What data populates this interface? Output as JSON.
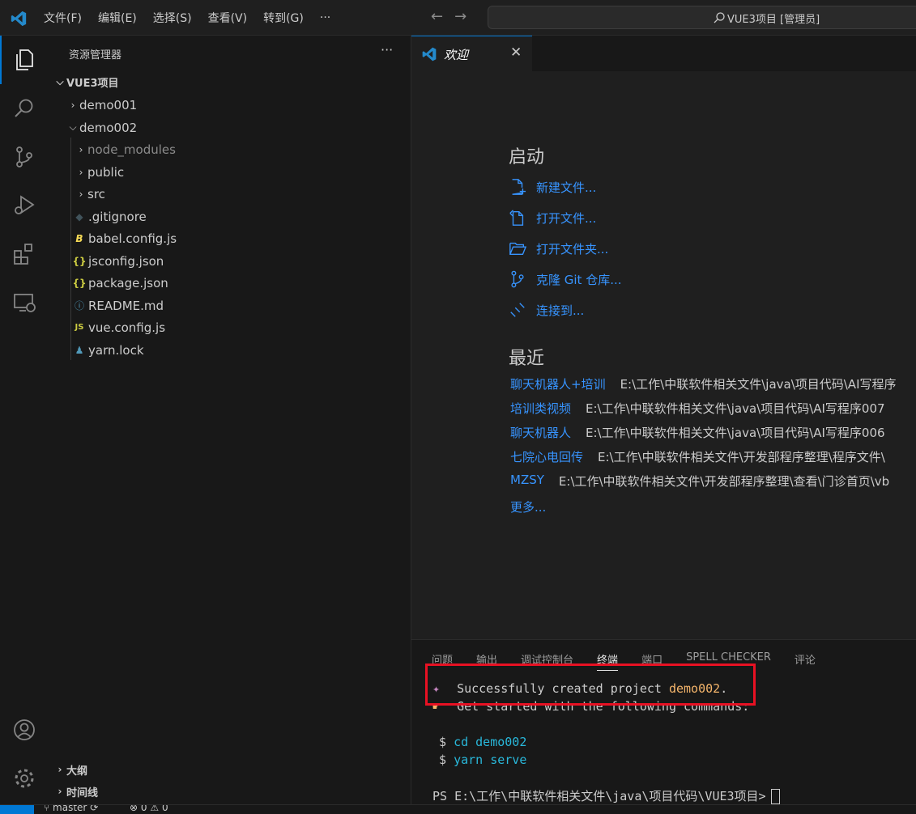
{
  "menu": [
    "文件(F)",
    "编辑(E)",
    "选择(S)",
    "查看(V)",
    "转到(G)"
  ],
  "menu_more": "···",
  "search": {
    "label": "VUE3项目 [管理员]"
  },
  "sidebar": {
    "title": "资源管理器",
    "more": "···",
    "root": "VUE3项目",
    "items": [
      {
        "label": "demo001",
        "kind": "folder",
        "expanded": false
      },
      {
        "label": "demo002",
        "kind": "folder",
        "expanded": true
      },
      {
        "label": "node_modules",
        "kind": "folder",
        "expanded": false
      },
      {
        "label": "public",
        "kind": "folder",
        "expanded": false
      },
      {
        "label": "src",
        "kind": "folder",
        "expanded": false
      },
      {
        "label": ".gitignore",
        "kind": "file",
        "icon": "git-icon"
      },
      {
        "label": "babel.config.js",
        "kind": "file",
        "icon": "babel-icon",
        "glyph": "B"
      },
      {
        "label": "jsconfig.json",
        "kind": "file",
        "icon": "json-icon",
        "glyph": "{}"
      },
      {
        "label": "package.json",
        "kind": "file",
        "icon": "json-icon",
        "glyph": "{}"
      },
      {
        "label": "README.md",
        "kind": "file",
        "icon": "info-icon",
        "glyph": "ⓘ"
      },
      {
        "label": "vue.config.js",
        "kind": "file",
        "icon": "js-icon",
        "glyph": "JS"
      },
      {
        "label": "yarn.lock",
        "kind": "file",
        "icon": "yarn-icon"
      }
    ],
    "outline": "大纲",
    "timeline": "时间线"
  },
  "tab": {
    "label": "欢迎",
    "close": "✕"
  },
  "welcome": {
    "start_heading": "启动",
    "start_items": [
      "新建文件...",
      "打开文件...",
      "打开文件夹...",
      "克隆 Git 仓库...",
      "连接到..."
    ],
    "recent_heading": "最近",
    "recent": [
      {
        "name": "聊天机器人+培训",
        "path": "E:\\工作\\中联软件相关文件\\java\\项目代码\\AI写程序"
      },
      {
        "name": "培训类视频",
        "path": "E:\\工作\\中联软件相关文件\\java\\项目代码\\AI写程序007"
      },
      {
        "name": "聊天机器人",
        "path": "E:\\工作\\中联软件相关文件\\java\\项目代码\\AI写程序006"
      },
      {
        "name": "七院心电回传",
        "path": "E:\\工作\\中联软件相关文件\\开发部程序整理\\程序文件\\"
      },
      {
        "name": "MZSY",
        "path": "E:\\工作\\中联软件相关文件\\开发部程序整理\\查看\\门诊首页\\vb"
      }
    ],
    "more": "更多..."
  },
  "panel": {
    "tabs": [
      "问题",
      "输出",
      "调试控制台",
      "终端",
      "端口",
      "SPELL CHECKER",
      "评论"
    ],
    "active_tab": "终端",
    "line1_prefix": "Successfully created project ",
    "line1_project": "demo002",
    "line1_suffix": ".",
    "line2": "Get started with the following commands:",
    "cmd1": "cd demo002",
    "cmd2": "yarn serve",
    "prompt": "PS E:\\工作\\中联软件相关文件\\java\\项目代码\\VUE3项目>"
  },
  "statusbar": {
    "branch": "master",
    "errors": "0",
    "warnings": "0"
  },
  "colors": {
    "accent": "#0078d4",
    "link": "#3794ff",
    "highlight": "#e81123"
  }
}
